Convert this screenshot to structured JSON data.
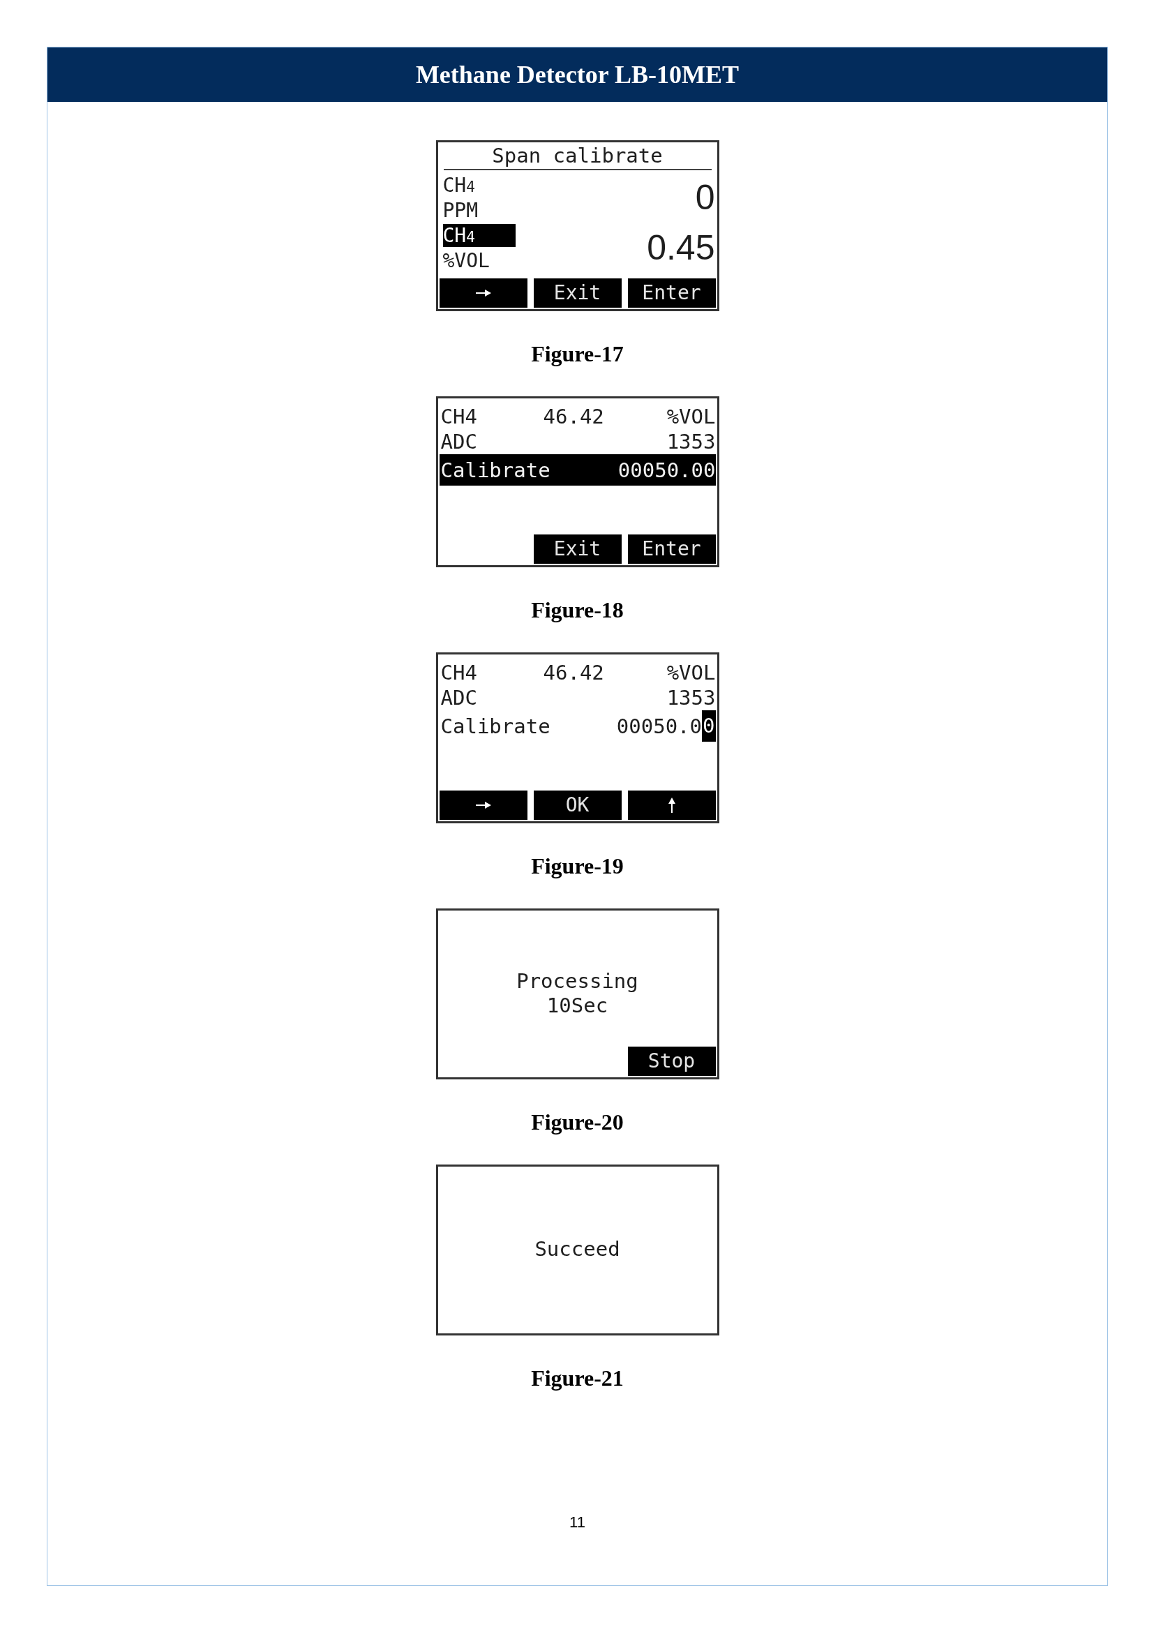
{
  "header": {
    "title": "Methane Detector LB-10MET"
  },
  "figures": [
    {
      "caption": "Figure-17",
      "screen": {
        "kind": "span_calibrate",
        "title": "Span calibrate",
        "readings": [
          {
            "gas": "CH$_{4}$",
            "unit": "PPM",
            "value": "0",
            "selected": false
          },
          {
            "gas": "CH$_{4}$",
            "unit": "%VOL",
            "value": "0.45",
            "selected": true
          }
        ],
        "softkeys": [
          {
            "kind": "arrow_right"
          },
          {
            "kind": "label",
            "label": "Exit"
          },
          {
            "kind": "label",
            "label": "Enter"
          }
        ]
      }
    },
    {
      "caption": "Figure-18",
      "screen": {
        "kind": "calibration",
        "rows": [
          {
            "label": "CH4",
            "reading": "46.42",
            "unit": "%VOL",
            "selected": false
          },
          {
            "label": "ADC",
            "value": "1353",
            "selected": false
          },
          {
            "label": "Calibrate",
            "value": "00050.00",
            "selected": true
          }
        ],
        "softkeys": [
          {
            "kind": "label",
            "label": "Exit"
          },
          {
            "kind": "label",
            "label": "Enter"
          }
        ]
      }
    },
    {
      "caption": "Figure-19",
      "screen": {
        "kind": "calibration",
        "rows": [
          {
            "label": "CH4",
            "reading": "46.42",
            "unit": "%VOL",
            "selected": false
          },
          {
            "label": "ADC",
            "value": "1353",
            "selected": false
          },
          {
            "label": "Calibrate",
            "value": "00050.0",
            "cursor": "0",
            "selected": false
          }
        ],
        "softkeys": [
          {
            "kind": "arrow_right"
          },
          {
            "kind": "label",
            "label": "OK"
          },
          {
            "kind": "arrow_up"
          }
        ]
      }
    },
    {
      "caption": "Figure-20",
      "screen": {
        "kind": "message",
        "lines": [
          "Processing",
          "10Sec"
        ],
        "softkeys": [
          {
            "kind": "label",
            "label": "Stop"
          }
        ]
      }
    },
    {
      "caption": "Figure-21",
      "screen": {
        "kind": "message",
        "lines": [
          "Succeed"
        ]
      }
    }
  ],
  "page_number": "11"
}
